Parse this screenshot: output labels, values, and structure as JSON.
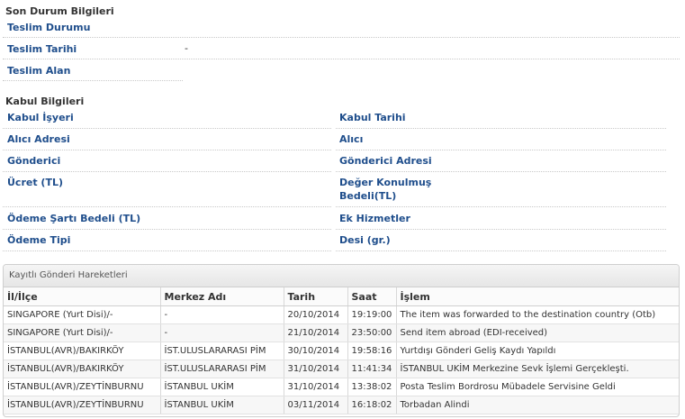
{
  "son_durum": {
    "title": "Son Durum Bilgileri",
    "teslim_durumu": "Teslim Durumu",
    "teslim_tarihi": "Teslim Tarihi",
    "teslim_tarihi_value": "-",
    "teslim_alan": "Teslim Alan"
  },
  "kabul": {
    "title": "Kabul Bilgileri",
    "kabul_isyeri": "Kabul İşyeri",
    "kabul_tarihi": "Kabul Tarihi",
    "alici_adresi": "Alıcı Adresi",
    "alici": "Alıcı",
    "gonderici": "Gönderici",
    "gonderici_adresi": "Gönderici Adresi",
    "ucret": "Ücret (TL)",
    "deger_line1": "Değer Konulmuş",
    "deger_line2": "Bedeli(TL)",
    "odeme_sarti": "Ödeme Şartı Bedeli (TL)",
    "ek_hizmetler": "Ek Hizmetler",
    "odeme_tipi": "Ödeme Tipi",
    "desi": "Desi (gr.)"
  },
  "hareketler": {
    "title": "Kayıtlı Gönderi Hareketleri",
    "columns": [
      "İl/İlçe",
      "Merkez Adı",
      "Tarih",
      "Saat",
      "İşlem"
    ],
    "rows": [
      [
        "SINGAPORE (Yurt Disi)/-",
        "-",
        "20/10/2014",
        "19:19:00",
        "The item was forwarded to the destination country (Otb)"
      ],
      [
        "SINGAPORE (Yurt Disi)/-",
        "-",
        "21/10/2014",
        "23:50:00",
        "Send item abroad (EDI-received)"
      ],
      [
        "İSTANBUL(AVR)/BAKIRKÖY",
        "İST.ULUSLARARASI PİM",
        "30/10/2014",
        "19:58:16",
        "Yurtdışı Gönderi Geliş Kaydı Yapıldı"
      ],
      [
        "İSTANBUL(AVR)/BAKIRKÖY",
        "İST.ULUSLARARASI PİM",
        "31/10/2014",
        "11:41:34",
        "İSTANBUL UKİM Merkezine Sevk İşlemi Gerçekleşti."
      ],
      [
        "İSTANBUL(AVR)/ZEYTİNBURNU",
        "İSTANBUL UKİM",
        "31/10/2014",
        "13:38:02",
        "Posta Teslim Bordrosu Mübadele Servisine Geldi"
      ],
      [
        "İSTANBUL(AVR)/ZEYTİNBURNU",
        "İSTANBUL UKİM",
        "03/11/2014",
        "16:18:02",
        "Torbadan Alindi"
      ]
    ]
  }
}
